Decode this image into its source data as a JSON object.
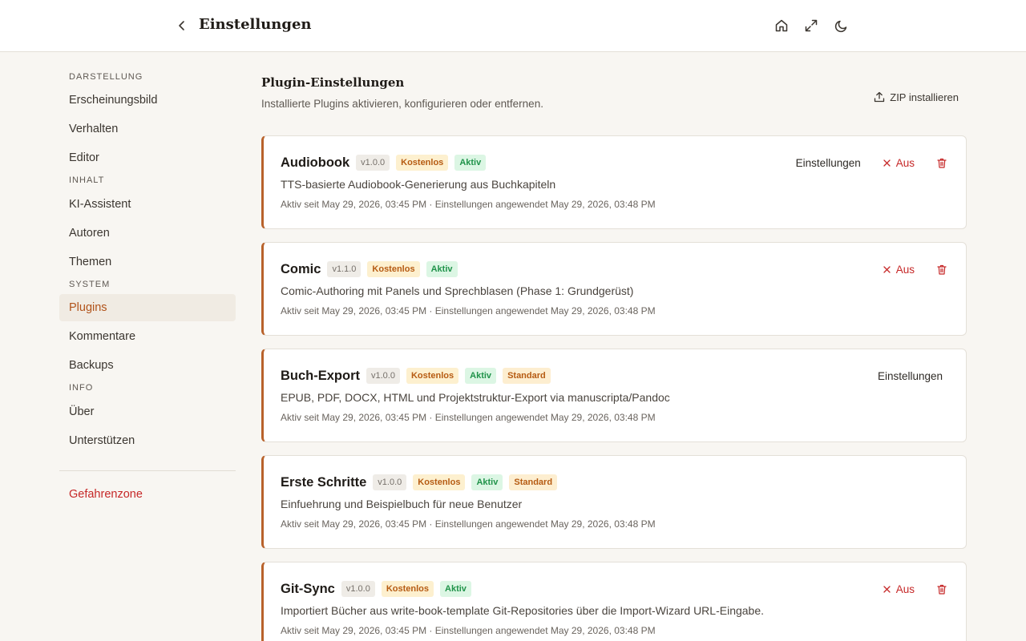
{
  "header": {
    "title": "Einstellungen"
  },
  "sidebar": {
    "sections": [
      {
        "label": "DARSTELLUNG"
      },
      {
        "label": "INHALT"
      },
      {
        "label": "SYSTEM"
      },
      {
        "label": "INFO"
      }
    ],
    "items": [
      {
        "label": "Erscheinungsbild"
      },
      {
        "label": "Verhalten"
      },
      {
        "label": "Editor"
      },
      {
        "label": "KI-Assistent"
      },
      {
        "label": "Autoren"
      },
      {
        "label": "Themen"
      },
      {
        "label": "Plugins",
        "active": true
      },
      {
        "label": "Kommentare"
      },
      {
        "label": "Backups"
      },
      {
        "label": "Über"
      },
      {
        "label": "Unterstützen"
      }
    ],
    "danger": "Gefahrenzone"
  },
  "main": {
    "title": "Plugin-Einstellungen",
    "subtitle": "Installierte Plugins aktivieren, konfigurieren oder entfernen.",
    "zip_button": "ZIP installieren",
    "labels": {
      "settings": "Einstellungen",
      "off": "Aus"
    },
    "plugins": [
      {
        "name": "Audiobook",
        "version": "v1.0.0",
        "badges": [
          "Kostenlos",
          "Aktiv"
        ],
        "description": "TTS-basierte Audiobook-Generierung aus Buchkapiteln",
        "meta": "Aktiv seit May 29, 2026, 03:45 PM · Einstellungen angewendet May 29, 2026, 03:48 PM"
      },
      {
        "name": "Comic",
        "version": "v1.1.0",
        "badges": [
          "Kostenlos",
          "Aktiv"
        ],
        "description": "Comic-Authoring mit Panels und Sprechblasen (Phase 1: Grundgerüst)",
        "meta": "Aktiv seit May 29, 2026, 03:45 PM · Einstellungen angewendet May 29, 2026, 03:48 PM"
      },
      {
        "name": "Buch-Export",
        "version": "v1.0.0",
        "badges": [
          "Kostenlos",
          "Aktiv",
          "Standard"
        ],
        "description": "EPUB, PDF, DOCX, HTML und Projektstruktur-Export via manuscripta/Pandoc",
        "meta": "Aktiv seit May 29, 2026, 03:45 PM · Einstellungen angewendet May 29, 2026, 03:48 PM"
      },
      {
        "name": "Erste Schritte",
        "version": "v1.0.0",
        "badges": [
          "Kostenlos",
          "Aktiv",
          "Standard"
        ],
        "description": "Einfuehrung und Beispielbuch für neue Benutzer",
        "meta": "Aktiv seit May 29, 2026, 03:45 PM · Einstellungen angewendet May 29, 2026, 03:48 PM"
      },
      {
        "name": "Git-Sync",
        "version": "v1.0.0",
        "badges": [
          "Kostenlos",
          "Aktiv"
        ],
        "description": "Importiert Bücher aus write-book-template Git-Repositories über die Import-Wizard URL-Eingabe.",
        "meta": "Aktiv seit May 29, 2026, 03:45 PM · Einstellungen angewendet May 29, 2026, 03:48 PM"
      }
    ]
  },
  "colors": {
    "accent": "#b8622b",
    "danger": "#c62828",
    "active_badge": "#20934a"
  }
}
